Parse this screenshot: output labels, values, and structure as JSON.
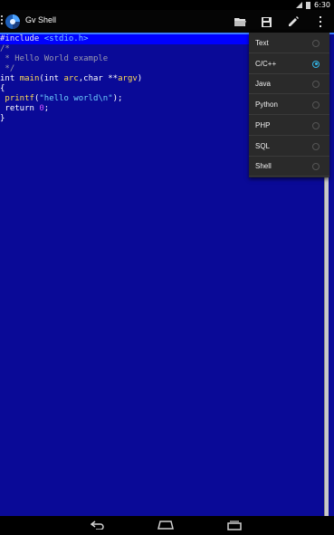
{
  "status_bar": {
    "time": "6:30",
    "icons": [
      "signal-icon",
      "battery-icon"
    ]
  },
  "action_bar": {
    "title": "Gv Shell",
    "actions": [
      {
        "name": "open-folder-icon"
      },
      {
        "name": "save-icon"
      },
      {
        "name": "pencil-icon"
      },
      {
        "name": "overflow-menu-icon"
      }
    ]
  },
  "editor": {
    "lines": [
      [
        {
          "t": "#include ",
          "c": "pp"
        },
        {
          "t": "<stdio.h>",
          "c": "ppinc"
        }
      ],
      [
        {
          "t": "/*",
          "c": "comment"
        }
      ],
      [
        {
          "t": " * Hello World example",
          "c": "comment"
        }
      ],
      [
        {
          "t": " */",
          "c": "comment"
        }
      ],
      [
        {
          "t": "int ",
          "c": "type"
        },
        {
          "t": "main",
          "c": "fn"
        },
        {
          "t": "(",
          "c": "punct"
        },
        {
          "t": "int ",
          "c": "type"
        },
        {
          "t": "arc",
          "c": "ident"
        },
        {
          "t": ",",
          "c": "punct"
        },
        {
          "t": "char ",
          "c": "type"
        },
        {
          "t": "**",
          "c": "punct"
        },
        {
          "t": "argv",
          "c": "ident"
        },
        {
          "t": ")",
          "c": "punct"
        }
      ],
      [
        {
          "t": "{",
          "c": "punct"
        }
      ],
      [
        {
          "t": " printf",
          "c": "fn"
        },
        {
          "t": "(",
          "c": "punct"
        },
        {
          "t": "\"hello world\\n\"",
          "c": "str"
        },
        {
          "t": ");",
          "c": "punct"
        }
      ],
      [
        {
          "t": " return ",
          "c": "kw"
        },
        {
          "t": "0",
          "c": "num"
        },
        {
          "t": ";",
          "c": "punct"
        }
      ],
      [
        {
          "t": "}",
          "c": "punct"
        }
      ]
    ],
    "current_line": 0
  },
  "language_menu": {
    "items": [
      {
        "label": "Text",
        "checked": false
      },
      {
        "label": "C/C++",
        "checked": true
      },
      {
        "label": "Java",
        "checked": false
      },
      {
        "label": "Python",
        "checked": false
      },
      {
        "label": "PHP",
        "checked": false
      },
      {
        "label": "SQL",
        "checked": false
      },
      {
        "label": "Shell",
        "checked": false
      }
    ]
  },
  "nav_bar": {
    "buttons": [
      "back-icon",
      "home-icon",
      "recents-icon"
    ]
  },
  "colors": {
    "editor_bg": "#0a0a97",
    "current_line": "#0000ff",
    "accent": "#33b5e5"
  }
}
